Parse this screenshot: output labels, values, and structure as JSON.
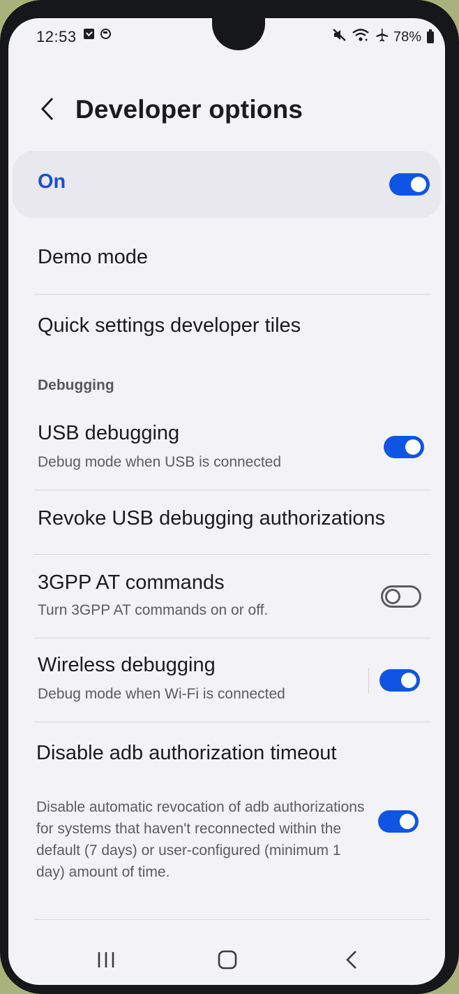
{
  "status_bar": {
    "time": "12:53",
    "battery": "78%",
    "icons": [
      "checkbox-notification-icon",
      "sync-notification-icon",
      "mute-icon",
      "wifi-icon",
      "airplane-icon",
      "battery-icon"
    ]
  },
  "header": {
    "title": "Developer options",
    "back_icon": "chevron-left-icon"
  },
  "master_switch": {
    "label": "On",
    "enabled": true
  },
  "items_top": [
    {
      "title": "Demo mode"
    },
    {
      "title": "Quick settings developer tiles"
    }
  ],
  "section": {
    "title": "Debugging"
  },
  "debugging_items": [
    {
      "title": "USB debugging",
      "subtitle": "Debug mode when USB is connected",
      "toggle": true
    },
    {
      "title": "Revoke USB debugging authorizations"
    },
    {
      "title": "3GPP AT commands",
      "subtitle": "Turn 3GPP AT commands on or off.",
      "toggle": false
    },
    {
      "title": "Wireless debugging",
      "subtitle": "Debug mode when Wi-Fi is connected",
      "toggle": true
    },
    {
      "title": "Disable adb authorization timeout",
      "subtitle": "Disable automatic revocation of adb authorizations for systems that haven't reconnected within the default (7 days) or user-configured (minimum 1 day) amount of time.",
      "toggle": true
    }
  ],
  "nav_bar": {
    "buttons": [
      "recents-icon",
      "home-icon",
      "back-icon"
    ]
  },
  "colors": {
    "accent": "#0f55e3",
    "master_label": "#1b4fd1",
    "background": "#f3f3f6",
    "card": "#e8e8ee"
  }
}
